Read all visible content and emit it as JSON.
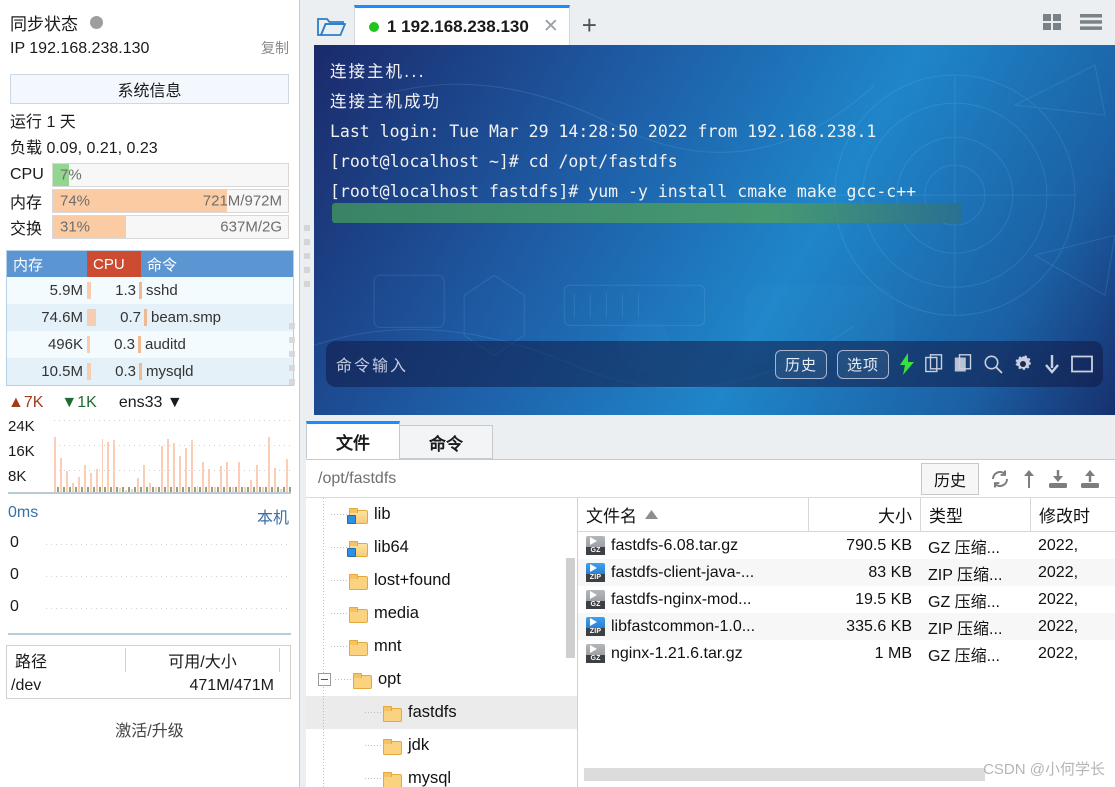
{
  "sidebar": {
    "sync_label": "同步状态",
    "ip_label": "IP 192.168.238.130",
    "copy_label": "复制",
    "sysinfo_button": "系统信息",
    "uptime": "运行 1 天",
    "load": "负载 0.09, 0.21, 0.23",
    "meters": [
      {
        "name": "CPU",
        "pct_text": "7%",
        "pct": 7,
        "right_text": "",
        "color": "#92d68f"
      },
      {
        "name": "内存",
        "pct_text": "74%",
        "pct": 74,
        "right_text": "721M/972M",
        "color": "#fbcca4"
      },
      {
        "name": "交换",
        "pct_text": "31%",
        "pct": 31,
        "right_text": "637M/2G",
        "color": "#fbcca4"
      }
    ],
    "processes": {
      "headers": {
        "mem": "内存",
        "cpu": "CPU",
        "cmd": "命令"
      },
      "rows": [
        {
          "mem": "5.9M",
          "cpu": "1.3",
          "cmd": "sshd"
        },
        {
          "mem": "74.6M",
          "cpu": "0.7",
          "cmd": "beam.smp"
        },
        {
          "mem": "496K",
          "cpu": "0.3",
          "cmd": "auditd"
        },
        {
          "mem": "10.5M",
          "cpu": "0.3",
          "cmd": "mysqld"
        }
      ]
    },
    "network": {
      "up": "7K",
      "down": "1K",
      "interface": "ens33",
      "y_labels": [
        "24K",
        "16K",
        "8K"
      ]
    },
    "ping": {
      "latency": "0ms",
      "target": "本机",
      "y_labels": [
        "0",
        "0",
        "0"
      ]
    },
    "disk": {
      "headers": {
        "path": "路径",
        "avail": "可用/大小"
      },
      "rows": [
        {
          "path": "/dev",
          "avail": "471M/471M"
        }
      ]
    },
    "activate_label": "激活/升级"
  },
  "titlebar": {
    "tab_label": "1 192.168.238.130",
    "new_tab": "+",
    "folder_icon": "open-folder-icon",
    "grid_icon": "grid-view-icon",
    "menu_icon": "hamburger-menu-icon"
  },
  "terminal": {
    "lines": [
      {
        "text": "连接主机...",
        "cn": true
      },
      {
        "text": "连接主机成功",
        "cn": true
      },
      {
        "text": "Last login: Tue Mar 29 14:28:50 2022 from 192.168.238.1",
        "cn": false
      },
      {
        "text": "[root@localhost ~]# cd /opt/fastdfs",
        "cn": false
      },
      {
        "text": "[root@localhost fastdfs]# yum -y install cmake make gcc-c++",
        "cn": false
      }
    ],
    "input_placeholder": "命令输入",
    "history_button": "历史",
    "options_button": "选项",
    "icons": [
      "bolt-icon",
      "copy-icon",
      "paste-icon",
      "search-icon",
      "gear-icon",
      "download-icon",
      "window-icon"
    ]
  },
  "filepanel": {
    "tabs": [
      {
        "label": "文件",
        "active": true
      },
      {
        "label": "命令",
        "active": false
      }
    ],
    "path": "/opt/fastdfs",
    "history_button": "历史",
    "tools": [
      "refresh-icon",
      "sort-icon",
      "download-icon",
      "upload-icon"
    ],
    "tree": [
      {
        "label": "lib",
        "depth": 1,
        "expander": false,
        "link": true,
        "selected": false
      },
      {
        "label": "lib64",
        "depth": 1,
        "expander": false,
        "link": true,
        "selected": false
      },
      {
        "label": "lost+found",
        "depth": 1,
        "expander": false,
        "link": false,
        "selected": false
      },
      {
        "label": "media",
        "depth": 1,
        "expander": false,
        "link": false,
        "selected": false
      },
      {
        "label": "mnt",
        "depth": 1,
        "expander": false,
        "link": false,
        "selected": false
      },
      {
        "label": "opt",
        "depth": 1,
        "expander": true,
        "link": false,
        "selected": false
      },
      {
        "label": "fastdfs",
        "depth": 2,
        "expander": false,
        "link": false,
        "selected": true
      },
      {
        "label": "jdk",
        "depth": 2,
        "expander": false,
        "link": false,
        "selected": false
      },
      {
        "label": "mysql",
        "depth": 2,
        "expander": false,
        "link": false,
        "selected": false
      }
    ],
    "list": {
      "headers": {
        "name": "文件名",
        "size": "大小",
        "type": "类型",
        "mtime": "修改时"
      },
      "sort_indicator": "sort-asc-icon",
      "rows": [
        {
          "icon": "gz",
          "name": "fastdfs-6.08.tar.gz",
          "size": "790.5 KB",
          "type": "GZ 压缩...",
          "mtime": "2022,"
        },
        {
          "icon": "zip",
          "name": "fastdfs-client-java-...",
          "size": "83 KB",
          "type": "ZIP 压缩...",
          "mtime": "2022,"
        },
        {
          "icon": "gz",
          "name": "fastdfs-nginx-mod...",
          "size": "19.5 KB",
          "type": "GZ 压缩...",
          "mtime": "2022,"
        },
        {
          "icon": "zip",
          "name": "libfastcommon-1.0...",
          "size": "335.6 KB",
          "type": "ZIP 压缩...",
          "mtime": "2022,"
        },
        {
          "icon": "gz",
          "name": "nginx-1.21.6.tar.gz",
          "size": "1 MB",
          "type": "GZ 压缩...",
          "mtime": "2022,"
        }
      ]
    },
    "watermark": "CSDN @小何学长"
  },
  "colors": {
    "accent_blue": "#1a8cff",
    "header_blue": "#5b96d2",
    "cpu_red": "#cc4b31",
    "mem_orange": "#fbcca4",
    "cpu_green": "#92d68f",
    "net_up": "#a03b1c",
    "net_down": "#1f6b33"
  }
}
